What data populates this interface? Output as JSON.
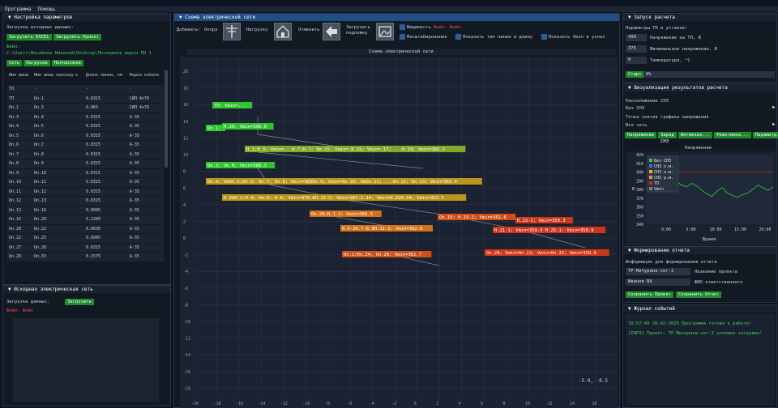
{
  "menu": {
    "program": "Программа",
    "help": "Помощь"
  },
  "left": {
    "title": "Настройка параметров",
    "load_heading": "Загрузка исходных данных:",
    "btn_excel": "Загрузить EXCEL",
    "btn_project": "Загрузить Проект",
    "file_label": "Файл:",
    "file_path": "C:\\Users\\Михайлов Николай\\Desktop\\Последняя верси ПО 1",
    "tabs": [
      "Сеть",
      "Нагрузка",
      "Полчасовки"
    ],
    "headers": [
      "Имя шины",
      "Имя шины присоед-я",
      "Длина линии, км",
      "Марка кабеля"
    ],
    "rows": [
      [
        "ТП",
        "-",
        "-",
        "-"
      ],
      [
        "ТП",
        "Оп.1",
        "0.0315",
        "СИП 4х70"
      ],
      [
        "Оп.1",
        "Оп.3",
        "0.063",
        "СИП 4х70"
      ],
      [
        "Оп.3",
        "Оп.4",
        "0.0315",
        "А-35"
      ],
      [
        "Оп.4",
        "Оп.5",
        "0.0315",
        "А-35"
      ],
      [
        "Оп.5",
        "Оп.6",
        "0.0315",
        "А-35"
      ],
      [
        "Оп.6",
        "Оп.7",
        "0.0315",
        "А-35"
      ],
      [
        "Оп.7",
        "Оп.8",
        "0.0315",
        "А-35"
      ],
      [
        "Оп.8",
        "Оп.9",
        "0.0315",
        "А-35"
      ],
      [
        "Оп.9",
        "Оп.10",
        "0.0315",
        "А-35"
      ],
      [
        "Оп.10",
        "Оп.11",
        "0.0315",
        "А-35"
      ],
      [
        "Оп.11",
        "Оп.12",
        "0.0315",
        "А-35"
      ],
      [
        "Оп.12",
        "Оп.13",
        "0.0315",
        "А-35"
      ],
      [
        "Оп.13",
        "Оп.16",
        "0.0945",
        "А-35"
      ],
      [
        "Оп.16",
        "Оп.20",
        "0.1260",
        "А-35"
      ],
      [
        "Оп.20",
        "Оп.22",
        "0.0630",
        "А-35"
      ],
      [
        "Оп.22",
        "Оп.25",
        "0.0945",
        "А-35"
      ],
      [
        "Оп.27",
        "Оп.28",
        "0.0315",
        "А-35"
      ],
      [
        "Оп.28",
        "Оп.33",
        "0.1575",
        "А-35"
      ]
    ],
    "source_title": "Исходная электрическая сеть",
    "source_load": "Загрузка данных:",
    "source_btn": "Загрузить",
    "source_file": "Файл: Файл"
  },
  "scheme": {
    "title": "Схема электрической сети",
    "add_label": "Добавить:",
    "support": "Опору",
    "load": "Нагрузку",
    "cancel": "Отменить",
    "load_base": "Загрузить подложку",
    "visibility": "Видимость",
    "visibility_file": "Файл: Файл",
    "scaling": "Масштабирование",
    "show_lines": "Показать тип линии и длину",
    "show_vmin": "Показать Vmin в узлах",
    "canvas_title": "Схема электрической сети",
    "coords": "-5.9, -8.5",
    "y_ticks": [
      "20",
      "18",
      "16",
      "14",
      "12",
      "10",
      "8",
      "6",
      "4",
      "2",
      "0",
      "-2",
      "-4",
      "-6",
      "-8",
      "-10",
      "-12",
      "-14",
      "-16",
      "-18"
    ],
    "x_ticks": [
      "-20",
      "-18",
      "-16",
      "-14",
      "-12",
      "-10",
      "-8",
      "-6",
      "-4",
      "-2",
      "0",
      "2",
      "4",
      "6",
      "8",
      "10",
      "12",
      "14",
      "16"
    ],
    "nodes": [
      {
        "text": "ТП; Vmin=...",
        "color": "#2fd32f"
      },
      {
        "text": "Оп.1;",
        "color": "#2fd32f"
      },
      {
        "text": "Н.10; Vmin=396.0",
        "color": "#2fd32f"
      },
      {
        "text": "Н.1;Н.3; Vmin=...Н.7;Н.7; Vm.15; Vmin=.8.15; Vmin=.17; ...Н.19; Vmin=366.2",
        "color": "#8ab32a"
      },
      {
        "text": "Оп.3; Vm.М; Vmin=388.3",
        "color": "#2fd32f"
      },
      {
        "text": "Оп.4; VmОп.5;Оп.6; Оп.7; Оп.8; Vmin=383Оп.9; Vmin=Оп.10; VmОп.11; ...Оп.12; Оп.13; Vmin=363.4",
        "color": "#c8a018"
      },
      {
        "text": "Н.2&Н.2;Н.4; Vm.6; Н.8; Vmin=370.8Н.12-2; Vmin=367.2.14; Vmin=Н.22Н.24; Vmin=363.3",
        "color": "#c8a018"
      },
      {
        "text": "Оп.20;Н.1-2; Vmin=366.5",
        "color": "#e07818"
      },
      {
        "text": "Н.5-2Н.7-8.9Н.11-2; Vmin=362.6",
        "color": "#e07818"
      },
      {
        "text": "Оп.16; Н.15-1; Vmin=361.6",
        "color": "#e05418"
      },
      {
        "text": "Н.23-1; Vmin=359.3",
        "color": "#e03818"
      },
      {
        "text": "Н.21-1; Vmin=359.9 Н.25-1; Vmin=358.9",
        "color": "#e03818"
      },
      {
        "text": "Оп.1/Оп.24; Оп.26; Vmin=362.7",
        "color": "#e05418"
      },
      {
        "text": "Оп.28; Vmin=Оп.22; Vmin=Оп.32; Vmin=358.9",
        "color": "#e03818"
      }
    ]
  },
  "right": {
    "calc_title": "Запуск расчета",
    "params_label": "Параметры ТП и уставки:",
    "p1_value": "400",
    "p1_label": "Напряжение на ТП, В",
    "p2_value": "375",
    "p2_label": "Минимальное напряжение, В",
    "p3_value": "0",
    "p3_label": "Температура, °C",
    "start_btn": "Старт",
    "progress": "0%",
    "viz_title": "Визуализация результатов расчета",
    "place_label": "Расположение СНЗ",
    "no_snz": "Без СНЗ",
    "point_label": "Точка снятия графика напряжения",
    "all_net": "Вся сеть",
    "tabs": [
      "Напряжение",
      "Заряд СНЗ",
      "Активная...",
      "Реактивна...",
      "Параметр..."
    ],
    "chart_title": "Напряжение",
    "legend": [
      "Без СНЗ",
      "СНЗ о.м.",
      "СНЗ а.м.",
      "СНЗ р.м.",
      "ТП",
      "Vmin"
    ],
    "legend_colors": [
      "#2fd32f",
      "#3a6cff",
      "#ffb000",
      "#c8a070",
      "#e02020",
      "#808080"
    ],
    "y_ticks": [
      "420",
      "410",
      "400",
      "390",
      "380",
      "370",
      "360",
      "350",
      "340"
    ],
    "x_ticks": [
      "0:00",
      "5:00",
      "10:00",
      "15:00",
      "20:00"
    ],
    "x_label": "Время",
    "y_label": "В",
    "report_title": "Формирование отчета",
    "report_info": "Информация для формирования отчета",
    "project_value": "ТР-Мичурина-ver-2",
    "project_label": "Название проекта",
    "resp_value": "Иванов ВА",
    "resp_label": "ФИО ответственного",
    "save_project": "Сохранить Проект",
    "save_report": "Сохранить Отчет",
    "log_title": "Журнал событий",
    "log1": "10:57:49 26-02-2025 Программа готова к работе!",
    "log2": "[INFO] Проект: ТР-Мичурина-ver-2 успешно загружен!"
  },
  "chart_data": {
    "type": "line",
    "title": "Напряжение",
    "xlabel": "Время",
    "ylabel": "В",
    "ylim": [
      340,
      420
    ],
    "x_ticks": [
      "0:00",
      "5:00",
      "10:00",
      "15:00",
      "20:00"
    ],
    "series": [
      {
        "name": "Без СНЗ",
        "values": [
          381,
          378,
          382,
          384,
          380,
          386,
          389,
          385,
          383,
          387,
          384,
          379,
          375,
          372,
          378,
          382,
          376,
          373,
          371,
          374,
          376,
          380,
          385,
          382,
          379,
          383
        ]
      },
      {
        "name": "ТП",
        "values": [
          400,
          400,
          400,
          400,
          400,
          400,
          400,
          400,
          400,
          400,
          400,
          400,
          400,
          400,
          400,
          400,
          400,
          400,
          400,
          400,
          400,
          400,
          400,
          400,
          400,
          400
        ]
      }
    ]
  }
}
